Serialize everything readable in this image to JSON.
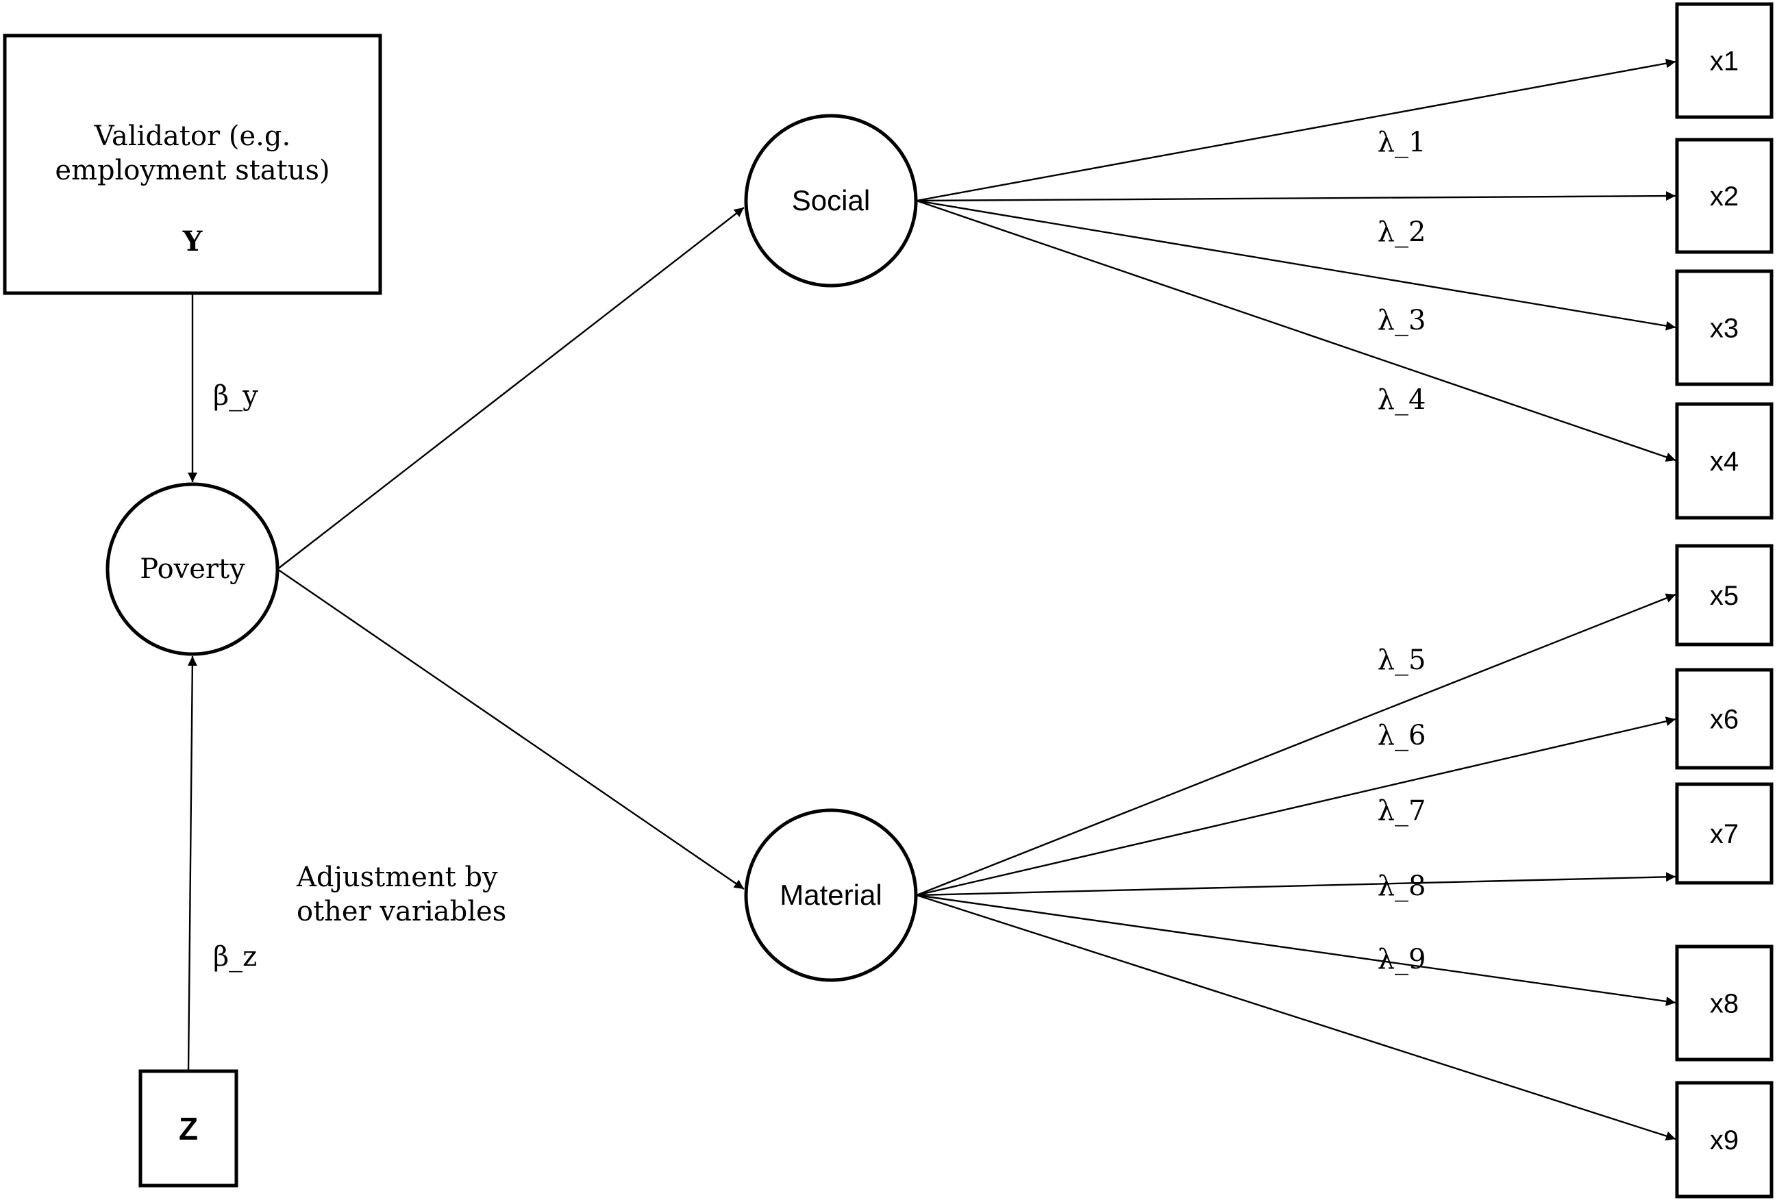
{
  "diagram": {
    "type": "path-model",
    "nodes": {
      "validator": {
        "kind": "observed",
        "label_line1": "Validator  (e.g.",
        "label_line2": "employment status)",
        "symbol": "Y"
      },
      "poverty": {
        "kind": "latent",
        "label": "Poverty"
      },
      "social": {
        "kind": "latent",
        "label": "Social"
      },
      "material": {
        "kind": "latent",
        "label": "Material"
      },
      "z": {
        "kind": "observed",
        "label": "Z"
      },
      "indicators": [
        {
          "id": "x1",
          "label": "x1",
          "factor": "social"
        },
        {
          "id": "x2",
          "label": "x2",
          "factor": "social"
        },
        {
          "id": "x3",
          "label": "x3",
          "factor": "social"
        },
        {
          "id": "x4",
          "label": "x4",
          "factor": "social"
        },
        {
          "id": "x5",
          "label": "x5",
          "factor": "material"
        },
        {
          "id": "x6",
          "label": "x6",
          "factor": "material"
        },
        {
          "id": "x7",
          "label": "x7",
          "factor": "material"
        },
        {
          "id": "x8",
          "label": "x8",
          "factor": "material"
        },
        {
          "id": "x9",
          "label": "x9",
          "factor": "material"
        }
      ]
    },
    "edges": [
      {
        "from": "validator",
        "to": "poverty",
        "label": "β_y"
      },
      {
        "from": "z",
        "to": "poverty",
        "label": "β_z"
      },
      {
        "from": "poverty",
        "to": "social",
        "label": ""
      },
      {
        "from": "poverty",
        "to": "material",
        "label": ""
      }
    ],
    "loadings": [
      "λ_1",
      "λ_2",
      "λ_3",
      "λ_4",
      "λ_5",
      "λ_6",
      "λ_7",
      "λ_8",
      "λ_9"
    ],
    "annotation": {
      "line1": "Adjustment by",
      "line2": "other variables"
    }
  }
}
